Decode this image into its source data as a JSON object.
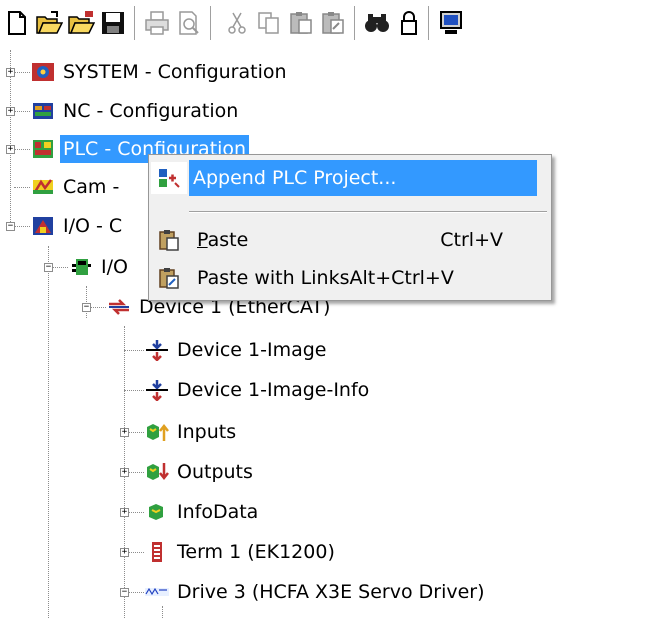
{
  "toolbar": {
    "buttons": [
      {
        "icon": "new-document-icon"
      },
      {
        "icon": "open-folder-icon"
      },
      {
        "icon": "open-folder-alt-icon"
      },
      {
        "icon": "save-icon"
      },
      {
        "icon": "print-icon"
      },
      {
        "icon": "print-preview-icon"
      },
      {
        "icon": "cut-icon"
      },
      {
        "icon": "copy-icon"
      },
      {
        "icon": "paste-icon"
      },
      {
        "icon": "paste-links-icon"
      },
      {
        "icon": "find-icon"
      },
      {
        "icon": "lock-icon"
      },
      {
        "icon": "monitor-icon"
      }
    ]
  },
  "tree": {
    "nodes": [
      {
        "label": "SYSTEM - Configuration",
        "icon": "system-config-icon"
      },
      {
        "label": "NC - Configuration",
        "icon": "nc-config-icon"
      },
      {
        "label": "PLC - Configuration",
        "icon": "plc-config-icon",
        "selected": true
      },
      {
        "label": "Cam - ",
        "icon": "cam-config-icon"
      },
      {
        "label": "I/O - C",
        "icon": "io-config-icon"
      },
      {
        "label": "I/O",
        "icon": "io-devices-icon"
      },
      {
        "label": "Device 1 (EtherCAT)",
        "icon": "ethercat-device-icon"
      },
      {
        "label": "Device 1-Image",
        "icon": "image-icon"
      },
      {
        "label": "Device 1-Image-Info",
        "icon": "image-info-icon"
      },
      {
        "label": "Inputs",
        "icon": "inputs-icon"
      },
      {
        "label": "Outputs",
        "icon": "outputs-icon"
      },
      {
        "label": "InfoData",
        "icon": "infodata-icon"
      },
      {
        "label": "Term 1 (EK1200)",
        "icon": "terminal-icon"
      },
      {
        "label": "Drive 3 (HCFA X3E Servo Driver)",
        "icon": "drive-icon"
      }
    ]
  },
  "context_menu": {
    "items": [
      {
        "label": "Append PLC Project...",
        "icon": "append-plc-icon",
        "highlighted": true,
        "shortcut": ""
      },
      {
        "label_mnemonic": "P",
        "label_rest": "aste",
        "icon": "paste-icon",
        "shortcut": "Ctrl+V"
      },
      {
        "label": "Paste with Links",
        "icon": "paste-links-icon",
        "shortcut": "Alt+Ctrl+V"
      }
    ]
  },
  "colors": {
    "selection": "#3399ff",
    "menu_bg": "#f0f0f0"
  }
}
